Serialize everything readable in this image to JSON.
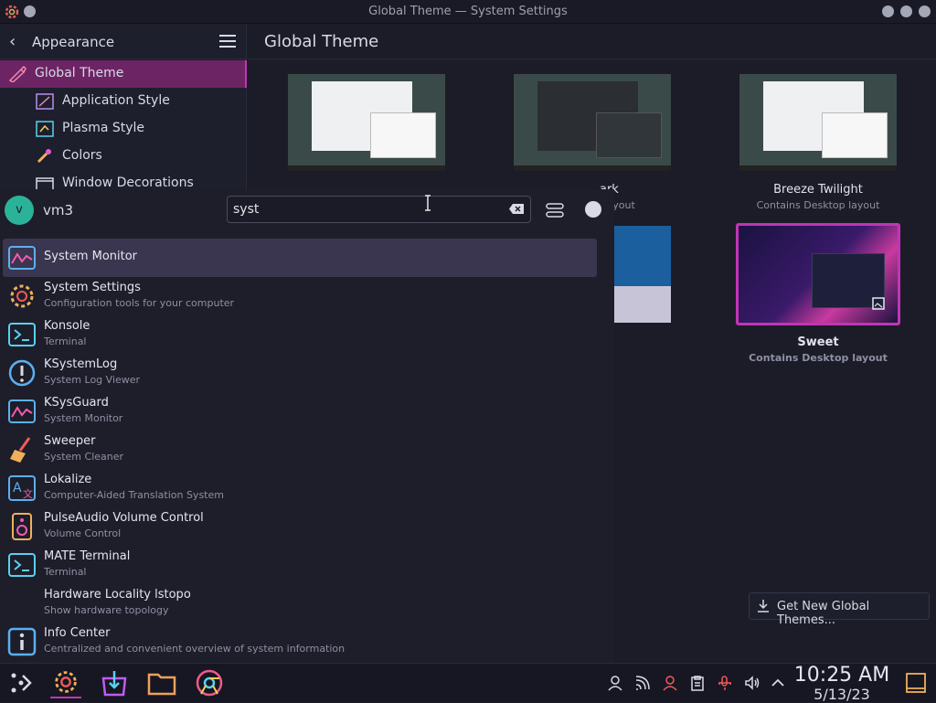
{
  "window": {
    "title": "Global Theme — System Settings"
  },
  "sidebar": {
    "section": "Appearance",
    "items": [
      {
        "label": "Global Theme",
        "icon": "global-theme-icon",
        "selected": true
      },
      {
        "label": "Application Style",
        "icon": "application-style-icon"
      },
      {
        "label": "Plasma Style",
        "icon": "plasma-style-icon"
      },
      {
        "label": "Colors",
        "icon": "colors-icon"
      },
      {
        "label": "Window Decorations",
        "icon": "window-decorations-icon"
      }
    ]
  },
  "content": {
    "title": "Global Theme",
    "themes": [
      {
        "name": "Breeze Twilight",
        "subtitle": "Contains Desktop layout"
      },
      {
        "name": "Sweet",
        "subtitle": "Contains Desktop layout",
        "selected": true
      }
    ],
    "partial_captions": [
      "ark",
      "p layout"
    ],
    "get_new": "Get New Global Themes..."
  },
  "launcher": {
    "user_initial": "v",
    "user_name": "vm3",
    "query": "syst",
    "results": [
      {
        "name": "System Monitor",
        "subtitle": "",
        "icon": "system-monitor-icon"
      },
      {
        "name": "System Settings",
        "subtitle": "Configuration tools for your computer",
        "icon": "system-settings-icon"
      },
      {
        "name": "Konsole",
        "subtitle": "Terminal",
        "icon": "konsole-icon"
      },
      {
        "name": "KSystemLog",
        "subtitle": "System Log Viewer",
        "icon": "ksystemlog-icon"
      },
      {
        "name": "KSysGuard",
        "subtitle": "System Monitor",
        "icon": "ksysguard-icon"
      },
      {
        "name": "Sweeper",
        "subtitle": "System Cleaner",
        "icon": "sweeper-icon"
      },
      {
        "name": "Lokalize",
        "subtitle": "Computer-Aided Translation System",
        "icon": "lokalize-icon"
      },
      {
        "name": "PulseAudio Volume Control",
        "subtitle": "Volume Control",
        "icon": "pulseaudio-icon"
      },
      {
        "name": "MATE Terminal",
        "subtitle": "Terminal",
        "icon": "mate-terminal-icon"
      },
      {
        "name": "Hardware Locality lstopo",
        "subtitle": "Show hardware topology",
        "icon": ""
      },
      {
        "name": "Info Center",
        "subtitle": "Centralized and convenient overview of system information",
        "icon": "info-center-icon"
      }
    ]
  },
  "taskbar": {
    "time": "10:25 AM",
    "date": "5/13/23"
  },
  "colors": {
    "accent": "#c035b5",
    "selection": "#6d2465",
    "background": "#1b1c28"
  }
}
